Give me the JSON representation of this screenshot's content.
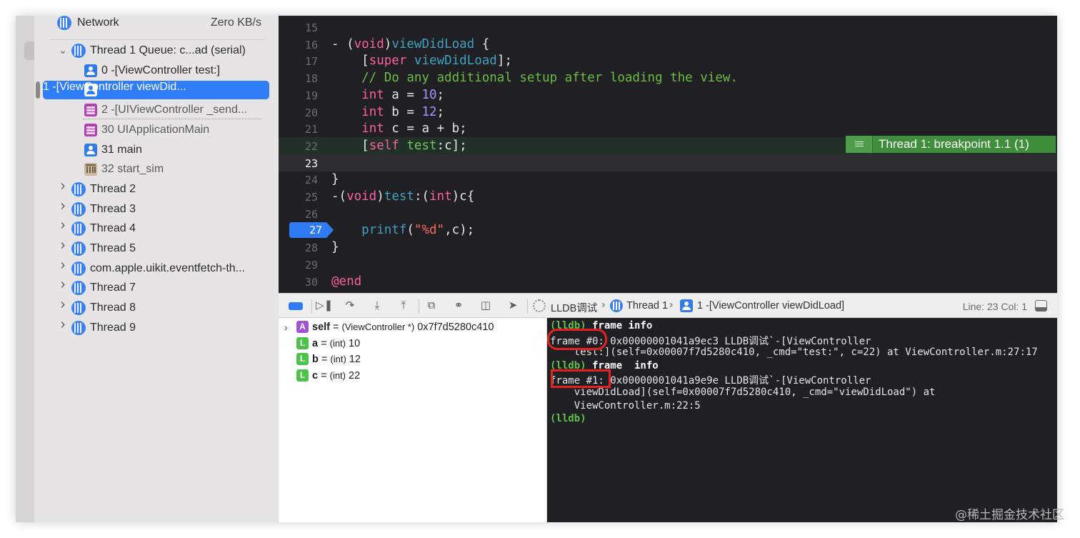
{
  "navigator": {
    "network": {
      "icon": "network-gauge-icon",
      "label": "Network",
      "value": "Zero KB/s"
    },
    "thread1": {
      "label": "Thread 1 Queue: c...ad (serial)",
      "expanded": true
    },
    "frames": [
      {
        "icon": "user-frame-icon",
        "label": "0 -[ViewController test:]"
      },
      {
        "icon": "user-frame-icon",
        "label": "1 -[ViewController viewDid...",
        "selected": true
      },
      {
        "icon": "system-stack-icon",
        "label": "2 -[UIViewController _send..."
      },
      {
        "icon": "system-stack-icon",
        "label": "30 UIApplicationMain"
      },
      {
        "icon": "user-frame-icon",
        "label": "31 main"
      },
      {
        "icon": "library-icon",
        "label": "32 start_sim"
      }
    ],
    "threads": [
      "Thread 2",
      "Thread 3",
      "Thread 4",
      "Thread 5",
      "com.apple.uikit.eventfetch-th...",
      "Thread 7",
      "Thread 8",
      "Thread 9"
    ]
  },
  "editor": {
    "lines": [
      {
        "n": "15",
        "parts": []
      },
      {
        "n": "16",
        "parts": [
          [
            "pl",
            "- ("
          ],
          [
            "k",
            "void"
          ],
          [
            "pl",
            ")"
          ],
          [
            "fn",
            "viewDidLoad"
          ],
          [
            "pl",
            " {"
          ]
        ]
      },
      {
        "n": "17",
        "parts": [
          [
            "pl",
            "    ["
          ],
          [
            "k",
            "super"
          ],
          [
            "pl",
            " "
          ],
          [
            "fn",
            "viewDidLoad"
          ],
          [
            "pl",
            "];"
          ]
        ]
      },
      {
        "n": "18",
        "parts": [
          [
            "cm",
            "    // Do any additional setup after loading the view."
          ]
        ]
      },
      {
        "n": "19",
        "parts": [
          [
            "pl",
            "    "
          ],
          [
            "k",
            "int"
          ],
          [
            "pl",
            " a = "
          ],
          [
            "num",
            "10"
          ],
          [
            "pl",
            ";"
          ]
        ]
      },
      {
        "n": "20",
        "parts": [
          [
            "pl",
            "    "
          ],
          [
            "k",
            "int"
          ],
          [
            "pl",
            " b = "
          ],
          [
            "num",
            "12"
          ],
          [
            "pl",
            ";"
          ]
        ]
      },
      {
        "n": "21",
        "parts": [
          [
            "pl",
            "    "
          ],
          [
            "k",
            "int"
          ],
          [
            "pl",
            " c = a + b;"
          ]
        ]
      },
      {
        "n": "22",
        "parts": [
          [
            "pl",
            "    ["
          ],
          [
            "k",
            "self"
          ],
          [
            "pl",
            " "
          ],
          [
            "grn",
            "test"
          ],
          [
            "pl",
            ":c];"
          ]
        ]
      },
      {
        "n": "23",
        "parts": []
      },
      {
        "n": "24",
        "parts": [
          [
            "pl",
            "}"
          ]
        ]
      },
      {
        "n": "25",
        "parts": [
          [
            "pl",
            "-("
          ],
          [
            "k",
            "void"
          ],
          [
            "pl",
            ")"
          ],
          [
            "fn",
            "test"
          ],
          [
            "pl",
            ":("
          ],
          [
            "k",
            "int"
          ],
          [
            "pl",
            ")c{"
          ]
        ]
      },
      {
        "n": "26",
        "parts": []
      },
      {
        "n": "27",
        "parts": [
          [
            "pl",
            "    "
          ],
          [
            "fn",
            "printf"
          ],
          [
            "pl",
            "("
          ],
          [
            "str",
            "\"%d\""
          ],
          [
            "pl",
            ",c);"
          ]
        ]
      },
      {
        "n": "28",
        "parts": [
          [
            "pl",
            "}"
          ]
        ]
      },
      {
        "n": "29",
        "parts": []
      },
      {
        "n": "30",
        "parts": [
          [
            "k",
            "@end"
          ]
        ]
      }
    ],
    "breakpoint_line": "27",
    "current_line": "23",
    "breakpoint_banner": "Thread 1: breakpoint 1.1 (1)"
  },
  "debug_bar": {
    "crumbs": [
      "LLDB调试",
      "Thread 1",
      "1 -[ViewController viewDidLoad]"
    ],
    "position": "Line: 23  Col: 1"
  },
  "variables": [
    {
      "badge": "A",
      "name": "self",
      "type": "(ViewController *)",
      "value": "0x7f7d5280c410",
      "expandable": true
    },
    {
      "badge": "L",
      "name": "a",
      "type": "(int)",
      "value": "10"
    },
    {
      "badge": "L",
      "name": "b",
      "type": "(int)",
      "value": "12"
    },
    {
      "badge": "L",
      "name": "c",
      "type": "(int)",
      "value": "22"
    }
  ],
  "console": {
    "lines": [
      [
        [
          "prompt",
          "(lldb)"
        ],
        [
          "cmd",
          " frame info"
        ]
      ],
      [
        [
          "pl",
          "frame #0: 0x00000001041a9ec3 LLDB调试`-[ViewController"
        ]
      ],
      [
        [
          "pl",
          "    test:](self=0x00007f7d5280c410, _cmd=\"test:\", c=22) at ViewController.m:27:17"
        ]
      ],
      [
        [
          "prompt",
          "(lldb)"
        ],
        [
          "cmd",
          " frame  info"
        ]
      ],
      [
        [
          "pl",
          "frame #1: 0x00000001041a9e9e LLDB调试`-[ViewController"
        ]
      ],
      [
        [
          "pl",
          "    viewDidLoad](self=0x00007f7d5280c410, _cmd=\"viewDidLoad\") at"
        ]
      ],
      [
        [
          "pl",
          "    ViewController.m:22:5"
        ]
      ],
      [
        [
          "prompt",
          "(lldb)"
        ]
      ]
    ]
  },
  "watermark": "@稀土掘金技术社区"
}
